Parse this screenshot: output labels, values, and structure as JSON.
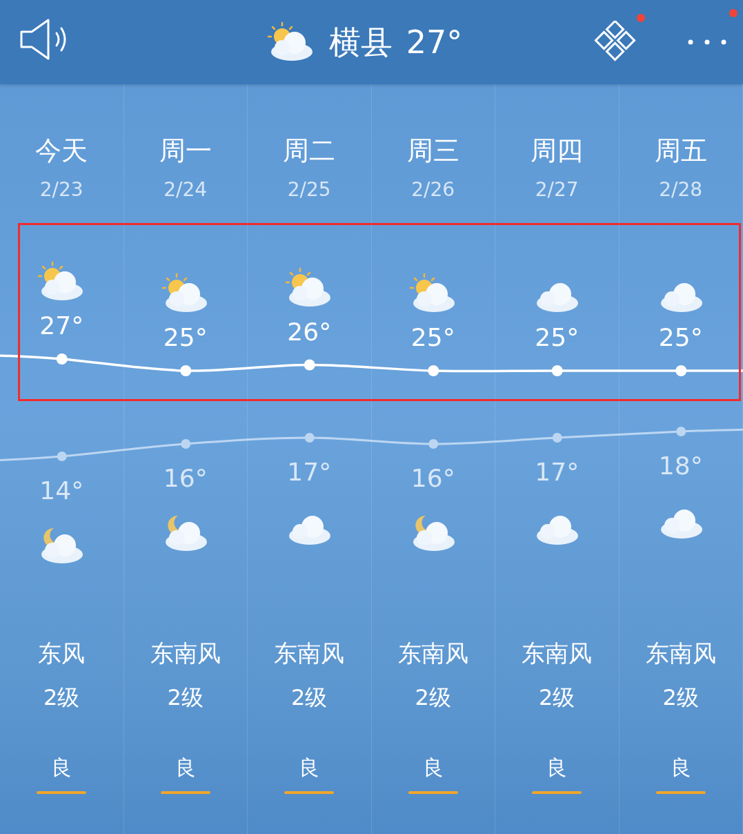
{
  "header": {
    "city": "横县",
    "temp": "27°",
    "weather": {
      "kind": "sun-cloud"
    },
    "apps_badge": true,
    "more_badge": true
  },
  "days": [
    {
      "day": "今天",
      "date": "2/23",
      "high": "27°",
      "day_weather": {
        "kind": "sun-cloud"
      },
      "low": "14°",
      "night_weather": {
        "kind": "moon-cloud"
      },
      "wind_dir": "东风",
      "wind_level": "2级",
      "air": "良"
    },
    {
      "day": "周一",
      "date": "2/24",
      "high": "25°",
      "day_weather": {
        "kind": "sun-cloud"
      },
      "low": "16°",
      "night_weather": {
        "kind": "moon-cloud"
      },
      "wind_dir": "东南风",
      "wind_level": "2级",
      "air": "良"
    },
    {
      "day": "周二",
      "date": "2/25",
      "high": "26°",
      "day_weather": {
        "kind": "sun-cloud"
      },
      "low": "17°",
      "night_weather": {
        "kind": "cloud"
      },
      "wind_dir": "东南风",
      "wind_level": "2级",
      "air": "良"
    },
    {
      "day": "周三",
      "date": "2/26",
      "high": "25°",
      "day_weather": {
        "kind": "sun-cloud"
      },
      "low": "16°",
      "night_weather": {
        "kind": "moon-cloud"
      },
      "wind_dir": "东南风",
      "wind_level": "2级",
      "air": "良"
    },
    {
      "day": "周四",
      "date": "2/27",
      "high": "25°",
      "day_weather": {
        "kind": "cloud"
      },
      "low": "17°",
      "night_weather": {
        "kind": "cloud"
      },
      "wind_dir": "东南风",
      "wind_level": "2级",
      "air": "良"
    },
    {
      "day": "周五",
      "date": "2/28",
      "high": "25°",
      "day_weather": {
        "kind": "cloud"
      },
      "low": "18°",
      "night_weather": {
        "kind": "cloud"
      },
      "wind_dir": "东南风",
      "wind_level": "2级",
      "air": "良"
    }
  ]
}
